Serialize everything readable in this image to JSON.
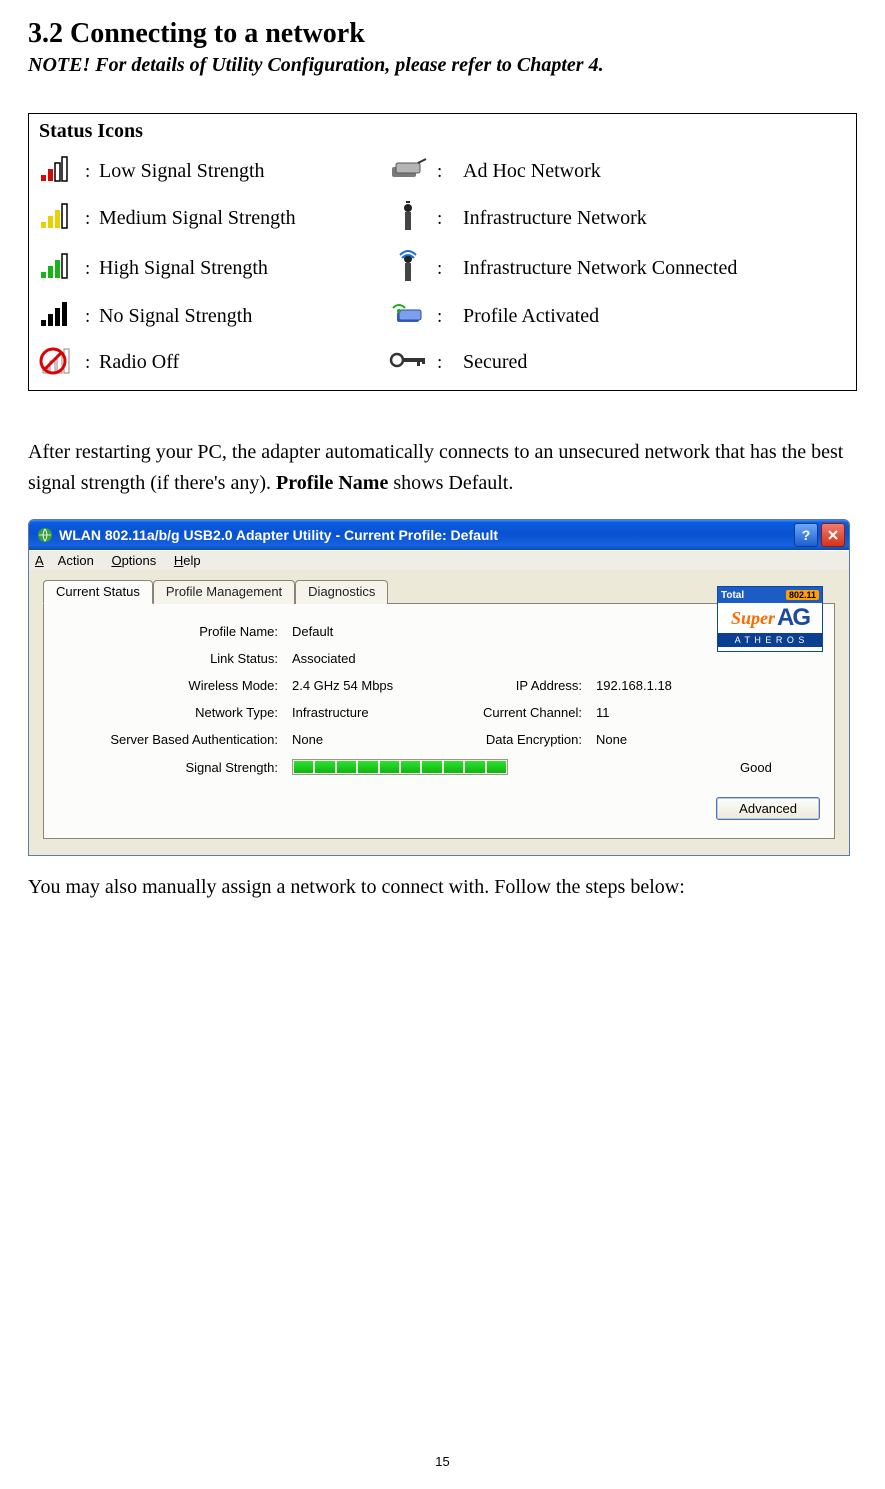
{
  "heading": "3.2 Connecting to a network",
  "note": "NOTE!    For details of Utility Configuration, please refer to Chapter 4.",
  "status_icons_title": "Status Icons",
  "status_icons": {
    "low_signal": "Low Signal Strength",
    "medium_signal": "Medium Signal Strength",
    "high_signal": "High Signal Strength",
    "no_signal": "No Signal Strength",
    "radio_off": "Radio Off",
    "ad_hoc": "Ad Hoc Network",
    "infra": "Infrastructure Network",
    "infra_conn": "Infrastructure Network Connected",
    "profile_act": "Profile Activated",
    "secured": "Secured"
  },
  "para1_pre": "After restarting your PC, the adapter automatically connects to an unsecured network that has the best signal strength (if there's any). ",
  "para1_bold": "Profile Name",
  "para1_post": " shows Default.",
  "window": {
    "title": "WLAN 802.11a/b/g USB2.0 Adapter Utility - Current Profile: Default",
    "menu": {
      "action": "Action",
      "options": "Options",
      "help": "Help"
    },
    "tabs": {
      "current": "Current Status",
      "profile": "Profile Management",
      "diag": "Diagnostics"
    },
    "fields": {
      "profile_name_l": "Profile Name:",
      "profile_name_v": "Default",
      "link_status_l": "Link Status:",
      "link_status_v": "Associated",
      "wireless_mode_l": "Wireless Mode:",
      "wireless_mode_v": "2.4 GHz 54 Mbps",
      "ip_l": "IP Address:",
      "ip_v": "192.168.1.18",
      "net_type_l": "Network Type:",
      "net_type_v": "Infrastructure",
      "chan_l": "Current Channel:",
      "chan_v": "11",
      "auth_l": "Server Based Authentication:",
      "auth_v": "None",
      "enc_l": "Data Encryption:",
      "enc_v": "None",
      "sig_l": "Signal Strength:",
      "sig_v": "Good"
    },
    "advanced_btn": "Advanced",
    "logo": {
      "total": "Total",
      "badge": "802.11",
      "super": "Super",
      "ag": "AG",
      "atheros": "A T H E R O S"
    }
  },
  "para2": "You may also manually assign a network to connect with. Follow the steps below:",
  "page_number": "15"
}
